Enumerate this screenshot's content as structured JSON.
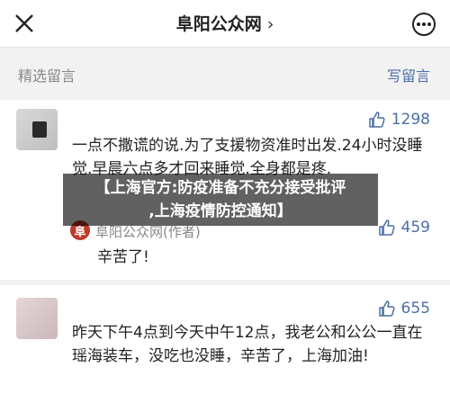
{
  "header": {
    "title": "阜阳公众网",
    "chevron": "›",
    "close_icon": "close-icon",
    "more_icon": "more-icon"
  },
  "section": {
    "title": "精选留言",
    "write_label": "写留言"
  },
  "comments": [
    {
      "likes": "1298",
      "text": "一点不撒谎的说.为了支援物资准时出发.24小时没睡觉.早晨六点多才回来睡觉.全身都是疼.",
      "reply": {
        "author": "阜阳公众网(作者)",
        "avatar_letter": "阜",
        "likes": "459",
        "text": "辛苦了!"
      }
    },
    {
      "likes": "655",
      "text": "昨天下午4点到今天中午12点，我老公和公公一直在瑶海装车，没吃也没睡，辛苦了，上海加油!"
    }
  ],
  "overlay": {
    "line1": "【上海官方:防疫准备不充分接受批评",
    "line2": ",上海疫情防控通知】"
  },
  "colors": {
    "link": "#4a6fa5",
    "reply_avatar": "#c0392b"
  }
}
